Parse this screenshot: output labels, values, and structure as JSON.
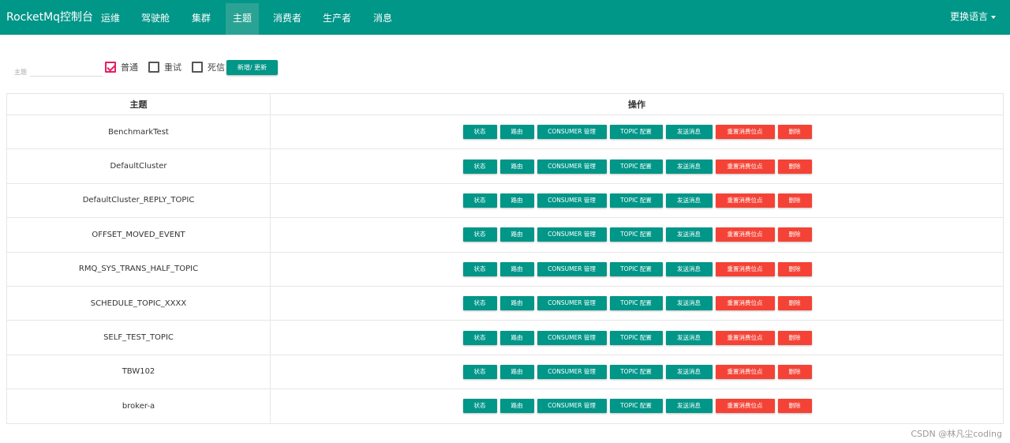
{
  "navbar": {
    "brand": "RocketMq控制台",
    "items": [
      "运维",
      "驾驶舱",
      "集群",
      "主题",
      "消费者",
      "生产者",
      "消息"
    ],
    "active": "主题",
    "language": "更换语言",
    "color": "#009688"
  },
  "filter": {
    "search_label": "主题",
    "search_value": "",
    "checkboxes": [
      {
        "label": "普通",
        "checked": true
      },
      {
        "label": "重试",
        "checked": false
      },
      {
        "label": "死信",
        "checked": false
      }
    ],
    "add_button": "新增/ 更新"
  },
  "table": {
    "headers": [
      "主题",
      "操作"
    ],
    "action_buttons": [
      {
        "label": "状态",
        "color": "#009688"
      },
      {
        "label": "路由",
        "color": "#009688"
      },
      {
        "label": "CONSUMER 管理",
        "color": "#009688"
      },
      {
        "label": "TOPIC 配置",
        "color": "#009688"
      },
      {
        "label": "发送消息",
        "color": "#009688"
      },
      {
        "label": "重置消费位点",
        "color": "#f44336"
      },
      {
        "label": "删除",
        "color": "#f44336"
      }
    ],
    "rows": [
      "BenchmarkTest",
      "DefaultCluster",
      "DefaultCluster_REPLY_TOPIC",
      "OFFSET_MOVED_EVENT",
      "RMQ_SYS_TRANS_HALF_TOPIC",
      "SCHEDULE_TOPIC_XXXX",
      "SELF_TEST_TOPIC",
      "TBW102",
      "broker-a"
    ]
  },
  "watermark": "CSDN @林凡尘coding"
}
